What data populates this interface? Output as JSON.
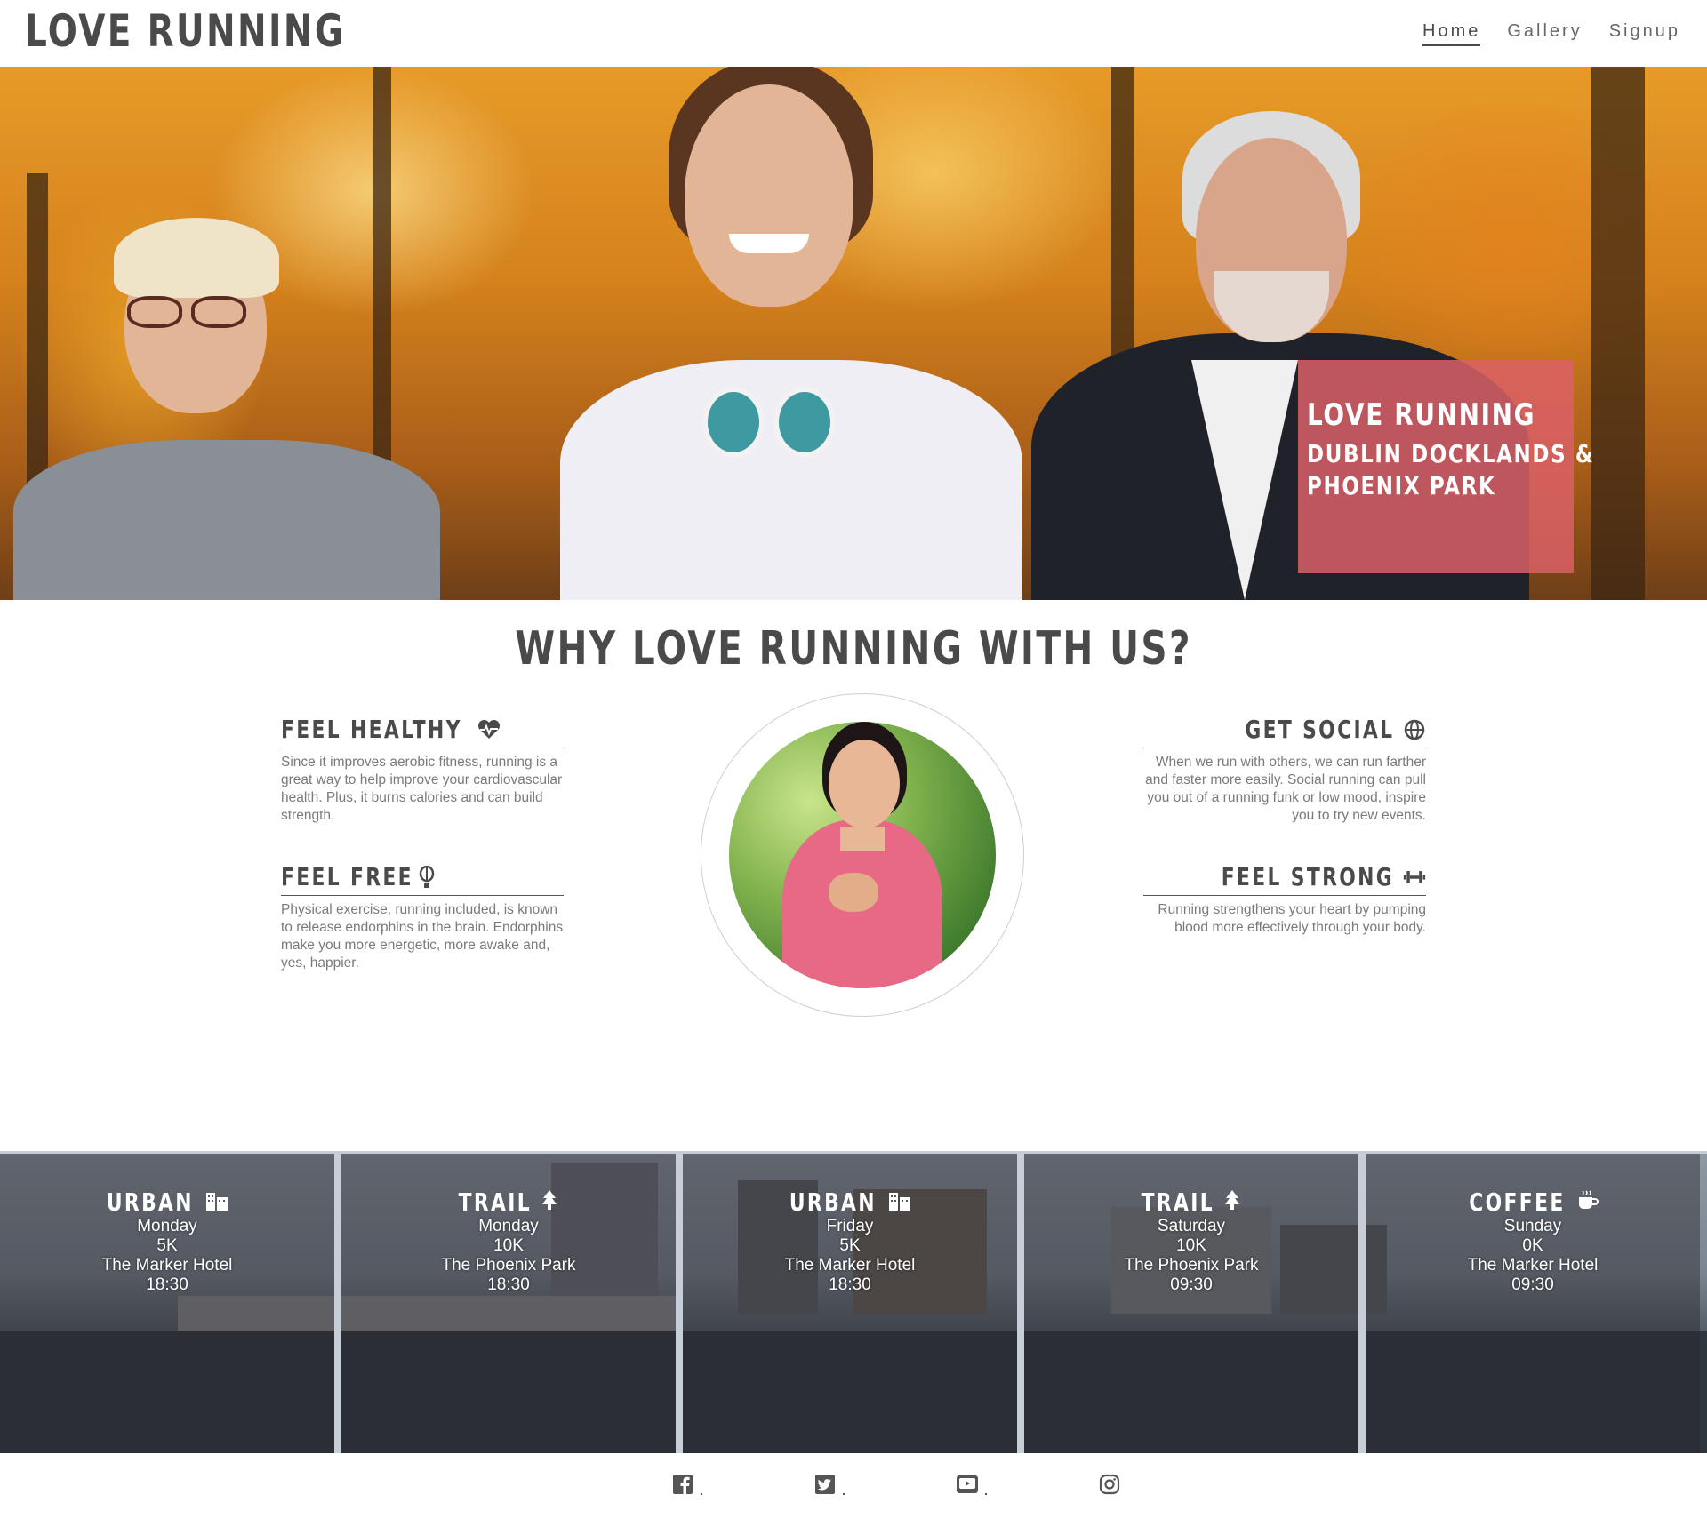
{
  "brand": {
    "title": "LOVE RUNNING"
  },
  "nav": {
    "items": [
      {
        "label": "Home",
        "active": true
      },
      {
        "label": "Gallery",
        "active": false
      },
      {
        "label": "Signup",
        "active": false
      }
    ]
  },
  "hero": {
    "caption_title": "LOVE RUNNING",
    "caption_line1": "DUBLIN DOCKLANDS &",
    "caption_line2": "PHOENIX PARK",
    "caption_color": "#da6066"
  },
  "why": {
    "title": "WHY LOVE RUNNING WITH US?",
    "features": [
      {
        "title": "FEEL HEALTHY",
        "icon": "heartbeat-icon",
        "text": "Since it improves aerobic fitness, running is a great way to help improve your cardiovascular health. Plus, it burns calories and can build strength."
      },
      {
        "title": "FEEL FREE",
        "icon": "balloon-icon",
        "text": "Physical exercise, running included, is known to release endorphins in the brain. Endorphins make you more energetic, more awake and, yes, happier."
      },
      {
        "title": "GET SOCIAL",
        "icon": "globe-icon",
        "text": "When we run with others, we can run farther and faster more easily. Social running can pull you out of a running funk or low mood, inspire you to try new events."
      },
      {
        "title": "FEEL STRONG",
        "icon": "dumbbell-icon",
        "text": "Running strengthens your heart by pumping blood more effectively through your body."
      }
    ]
  },
  "runs": [
    {
      "type": "URBAN",
      "icon": "building-icon",
      "day": "Monday",
      "distance": "5K",
      "location": "The Marker Hotel",
      "time": "18:30"
    },
    {
      "type": "TRAIL",
      "icon": "tree-icon",
      "day": "Monday",
      "distance": "10K",
      "location": "The Phoenix Park",
      "time": "18:30"
    },
    {
      "type": "URBAN",
      "icon": "building-icon",
      "day": "Friday",
      "distance": "5K",
      "location": "The Marker Hotel",
      "time": "18:30"
    },
    {
      "type": "TRAIL",
      "icon": "tree-icon",
      "day": "Saturday",
      "distance": "10K",
      "location": "The Phoenix Park",
      "time": "09:30"
    },
    {
      "type": "COFFEE",
      "icon": "coffee-icon",
      "day": "Sunday",
      "distance": "0K",
      "location": "The Marker Hotel",
      "time": "09:30"
    }
  ],
  "footer": {
    "social": [
      "facebook-icon",
      "twitter-icon",
      "youtube-icon",
      "instagram-icon"
    ]
  }
}
